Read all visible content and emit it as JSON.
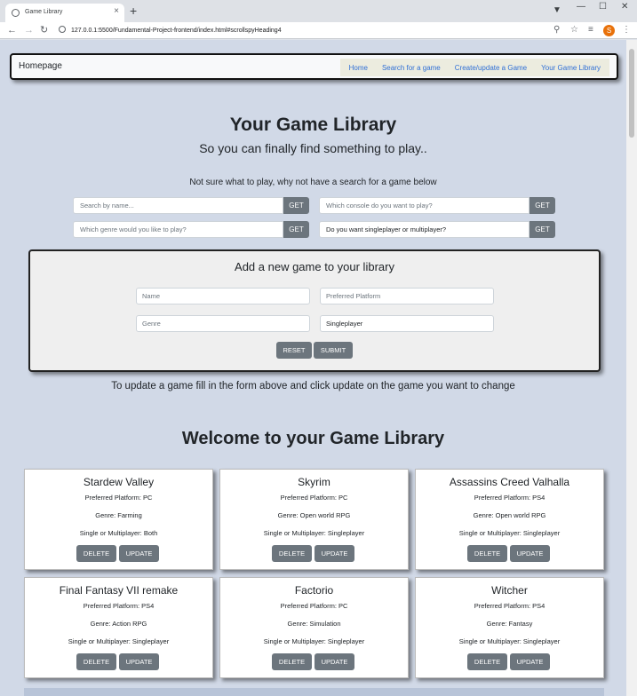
{
  "browser": {
    "tab_title": "Game Library",
    "tab_close": "×",
    "new_tab": "+",
    "url": "127.0.0.1:5500/Fundamental-Project-frontend/index.html#scrollspyHeading4",
    "profile_initial": "S"
  },
  "navbar": {
    "brand": "Homepage",
    "links": [
      "Home",
      "Search for a game",
      "Create/update a Game",
      "Your Game Library"
    ]
  },
  "hero": {
    "title": "Your Game Library",
    "subtitle": "So you can finally find something to play..",
    "prompt": "Not sure what to play, why not have a search for a game below"
  },
  "search": {
    "name_placeholder": "Search by name...",
    "console_placeholder": "Which console do you want to play?",
    "genre_placeholder": "Which genre would you like to play?",
    "mode_value": "Do you want singleplayer or multiplayer?",
    "get_label": "GET"
  },
  "add_form": {
    "title": "Add a new game to your library",
    "name_placeholder": "Name",
    "platform_placeholder": "Preferred Platform",
    "genre_placeholder": "Genre",
    "mode_value": "Singleplayer",
    "reset_label": "RESET",
    "submit_label": "SUBMIT"
  },
  "update_hint": "To update a game fill in the form above and click update on the game you want to change",
  "library": {
    "title": "Welcome to your Game Library",
    "delete_label": "DELETE",
    "update_label": "UPDATE",
    "games": [
      {
        "name": "Stardew Valley",
        "platform": "Preferred Platform: PC",
        "genre": "Genre: Farming",
        "mode": "Single or Multiplayer: Both"
      },
      {
        "name": "Skyrim",
        "platform": "Preferred Platform: PC",
        "genre": "Genre: Open world RPG",
        "mode": "Single or Multiplayer: Singleplayer"
      },
      {
        "name": "Assassins Creed Valhalla",
        "platform": "Preferred Platform: PS4",
        "genre": "Genre: Open world RPG",
        "mode": "Single or Multiplayer: Singleplayer"
      },
      {
        "name": "Final Fantasy VII remake",
        "platform": "Preferred Platform: PS4",
        "genre": "Genre: Action RPG",
        "mode": "Single or Multiplayer: Singleplayer"
      },
      {
        "name": "Factorio",
        "platform": "Preferred Platform: PC",
        "genre": "Genre: Simulation",
        "mode": "Single or Multiplayer: Singleplayer"
      },
      {
        "name": "Witcher",
        "platform": "Preferred Platform: PS4",
        "genre": "Genre: Fantasy",
        "mode": "Single or Multiplayer: Singleplayer"
      }
    ]
  }
}
